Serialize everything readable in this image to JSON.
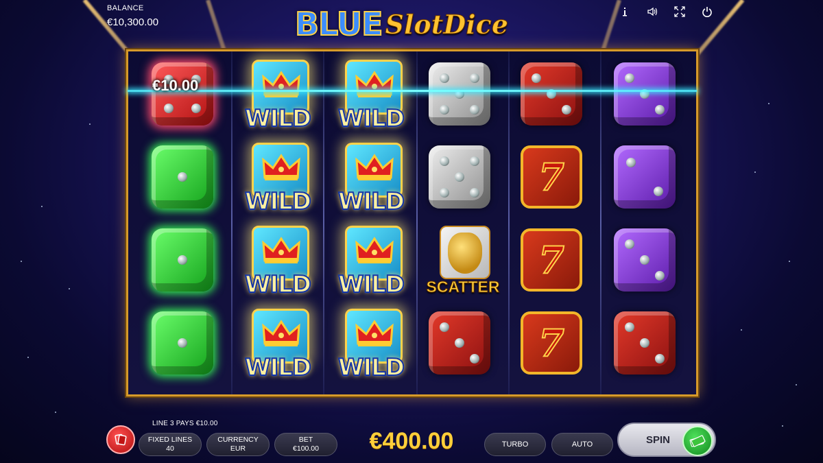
{
  "balance": {
    "label": "BALANCE",
    "value": "€10,300.00"
  },
  "logo": {
    "part1": "BLUE",
    "part2": "SlotDice"
  },
  "top_icons": [
    "info-icon",
    "sound-icon",
    "fullscreen-icon",
    "power-icon"
  ],
  "win": {
    "amount_label": "€10.00",
    "line_pays": "LINE 3 PAYS €10.00"
  },
  "reels": [
    {
      "symbols": [
        "red-die-4",
        "green-die-1",
        "green-die-1",
        "green-die-1"
      ]
    },
    {
      "symbols": [
        "wild",
        "wild",
        "wild",
        "wild"
      ]
    },
    {
      "symbols": [
        "wild",
        "wild",
        "wild",
        "wild"
      ]
    },
    {
      "symbols": [
        "grey-die-5",
        "grey-die-5",
        "scatter",
        "red-die-3"
      ]
    },
    {
      "symbols": [
        "red-die-3",
        "seven",
        "seven",
        "seven"
      ]
    },
    {
      "symbols": [
        "purple-die-3",
        "purple-die-2",
        "purple-die-3",
        "red-die-3"
      ]
    }
  ],
  "symbol_text": {
    "wild": "WILD",
    "scatter": "SCATTER",
    "seven": "7"
  },
  "controls": {
    "fixed_lines": {
      "label": "FIXED LINES",
      "value": "40"
    },
    "currency": {
      "label": "CURRENCY",
      "value": "EUR"
    },
    "bet": {
      "label": "BET",
      "value": "€100.00"
    },
    "total_bet": "€400.00",
    "turbo": "TURBO",
    "auto": "AUTO",
    "spin": "SPIN"
  },
  "colors": {
    "accent_gold": "#ffcf3a",
    "frame": "#d69a2a",
    "payline": "#39e6ff"
  }
}
